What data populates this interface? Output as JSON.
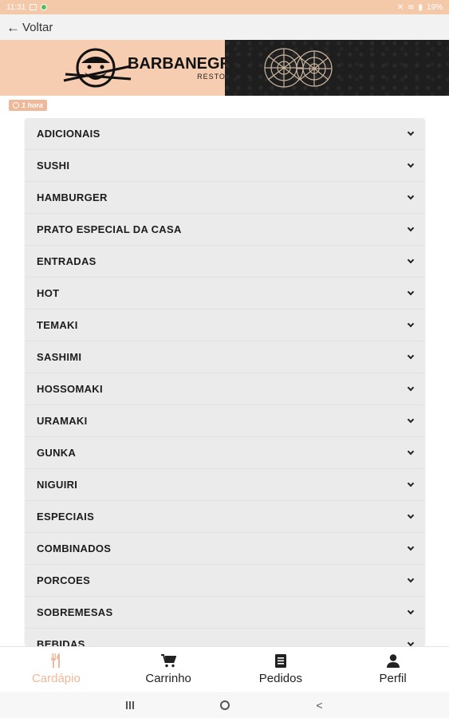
{
  "status_bar": {
    "time": "11:31",
    "battery": "19%"
  },
  "header": {
    "back_label": "Voltar"
  },
  "banner": {
    "brand_name": "BARBANEGRA",
    "brand_subtitle": "RESTOBAR"
  },
  "delivery": {
    "time_label": "1 hora"
  },
  "menu": {
    "categories": [
      {
        "label": "ADICIONAIS"
      },
      {
        "label": "SUSHI"
      },
      {
        "label": "HAMBURGER"
      },
      {
        "label": "PRATO ESPECIAL DA CASA"
      },
      {
        "label": "ENTRADAS"
      },
      {
        "label": "HOT"
      },
      {
        "label": "TEMAKI"
      },
      {
        "label": "SASHIMI"
      },
      {
        "label": "HOSSOMAKI"
      },
      {
        "label": "URAMAKI"
      },
      {
        "label": "GUNKA"
      },
      {
        "label": "NIGUIRI"
      },
      {
        "label": "ESPECIAIS"
      },
      {
        "label": "COMBINADOS"
      },
      {
        "label": "PORCOES"
      },
      {
        "label": "SOBREMESAS"
      },
      {
        "label": "BEBIDAS"
      }
    ]
  },
  "bottom_nav": {
    "items": [
      {
        "label": "Cardápio",
        "icon": "utensils-icon",
        "active": true
      },
      {
        "label": "Carrinho",
        "icon": "cart-icon",
        "active": false
      },
      {
        "label": "Pedidos",
        "icon": "receipt-icon",
        "active": false
      },
      {
        "label": "Perfil",
        "icon": "user-icon",
        "active": false
      }
    ]
  },
  "colors": {
    "accent": "#f0b898",
    "status_bar": "#f4c9a9",
    "banner_left": "#f6cdb0",
    "menu_bg": "#ebebeb"
  }
}
